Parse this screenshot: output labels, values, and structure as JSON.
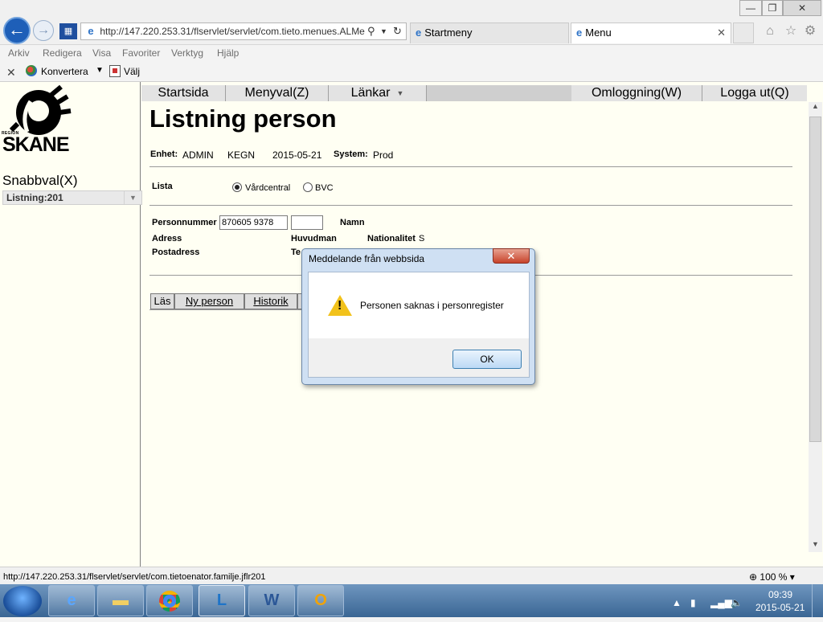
{
  "window": {
    "minimize": "—",
    "maximize": "❐",
    "close": "✕"
  },
  "browser": {
    "address": "http://147.220.253.31/flservlet/servlet/com.tieto.menues.ALMe",
    "tabs": [
      {
        "label": "Startmeny"
      },
      {
        "label": "Menu"
      }
    ],
    "menu": [
      "Arkiv",
      "Redigera",
      "Visa",
      "Favoriter",
      "Verktyg",
      "Hjälp"
    ],
    "toolbar": {
      "convert_label": "Konvertera",
      "select_label": "Välj"
    }
  },
  "sidebar": {
    "logo_region": "REGION",
    "logo_text": "SKANE",
    "snabbval_label": "Snabbval(X)",
    "snabbval_value": "Listning:201"
  },
  "topnav": {
    "start": "Startsida",
    "menyval": "Menyval(Z)",
    "lankar": "Länkar",
    "omloggning": "Omloggning(W)",
    "logout": "Logga ut(Q)"
  },
  "page": {
    "title": "Listning person",
    "enhet_label": "Enhet:",
    "enhet_value": "ADMIN",
    "enhet_code": "KEGN",
    "date": "2015-05-21",
    "system_label": "System:",
    "system_value": "Prod",
    "lista_label": "Lista",
    "radio_vardcentral": "Vårdcentral",
    "radio_bvc": "BVC",
    "personnummer_label": "Personnummer",
    "personnummer_value": "870605 9378",
    "namn_label": "Namn",
    "adress_label": "Adress",
    "huvudman_label": "Huvudman",
    "nationalitet_label": "Nationalitet",
    "nationalitet_value": "S",
    "postadress_label": "Postadress",
    "tel_label": "Te",
    "buttons": {
      "las": "Läs",
      "ny_person": "Ny person",
      "historik": "Historik"
    }
  },
  "statusbar": {
    "url": "http://147.220.253.31/flservlet/servlet/com.tietoenator.familje.jflr201",
    "zoom": "100 %"
  },
  "taskbar": {
    "time": "09:39",
    "date": "2015-05-21"
  },
  "dialog": {
    "title": "Meddelande från webbsida",
    "message": "Personen saknas i personregister",
    "ok": "OK",
    "close": "✕"
  }
}
